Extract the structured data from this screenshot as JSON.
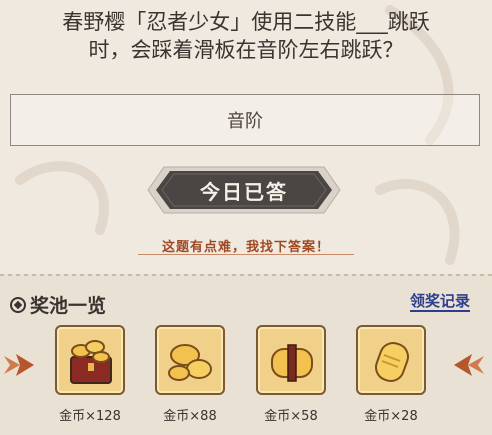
{
  "question": {
    "line1": "春野樱「忍者少女」使用二技能___跳跃",
    "line2": "时，会踩着滑板在音阶左右跳跃？"
  },
  "answer": {
    "text": "音阶"
  },
  "status_button": {
    "label": "今日已答"
  },
  "hint": {
    "text": "这题有点难，我找下答案！"
  },
  "pool": {
    "title": "奖池一览",
    "records_link": "领奖记录",
    "rewards": [
      {
        "label": "金币×128",
        "icon": "gold-coin-chest-icon"
      },
      {
        "label": "金币×88",
        "icon": "gold-coin-pile-icon"
      },
      {
        "label": "金币×58",
        "icon": "gold-coin-bundle-icon"
      },
      {
        "label": "金币×28",
        "icon": "gold-coin-icon"
      }
    ]
  },
  "colors": {
    "background": "#efe9e0",
    "button_dark": "#4a4643",
    "hint_red": "#a04a25",
    "link_blue": "#2e3e8c",
    "gold": "#f1d089",
    "arrow": "#b5562b"
  }
}
